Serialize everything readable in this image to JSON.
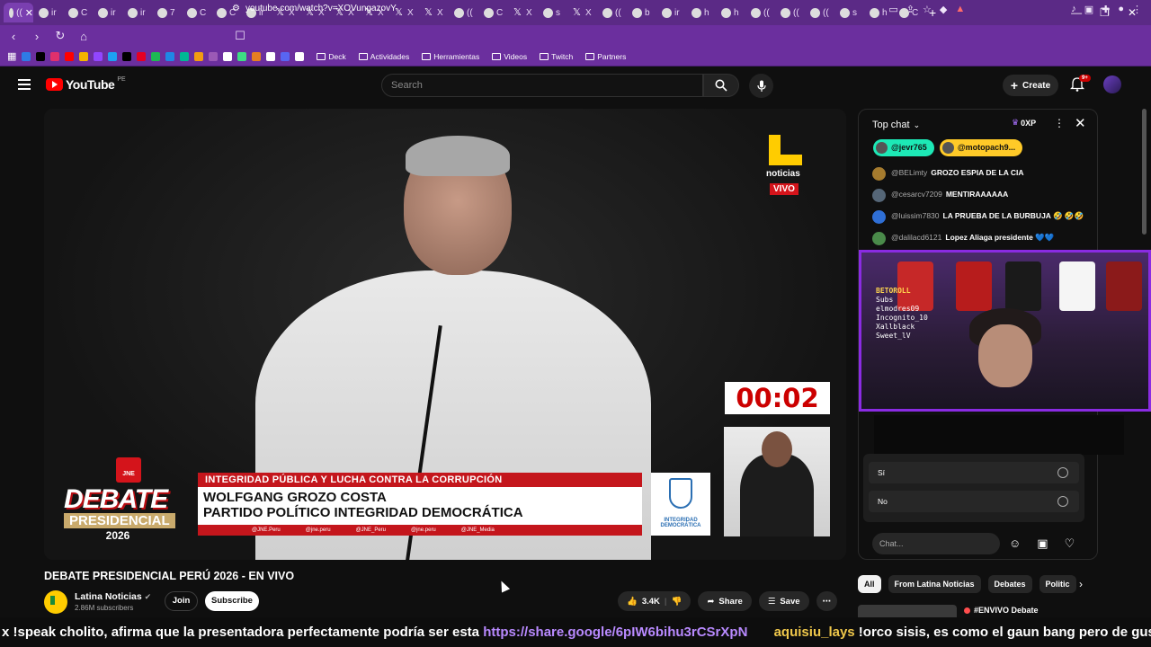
{
  "browser": {
    "tab_count_visible": 34,
    "url": "youtube.com/watch?v=XOVungazovY",
    "bookmarks": [
      "Deck",
      "Actividades",
      "Herramientas",
      "Videos",
      "Twitch",
      "Partners"
    ],
    "tab_labels": [
      "((",
      "ir",
      "C",
      "ir",
      "ir",
      "7",
      "C",
      "C",
      "ir",
      "X",
      "X",
      "X",
      "X",
      "X",
      "X",
      "((",
      "C",
      "X",
      "s",
      "X",
      "((",
      "b",
      "ir",
      "h",
      "h",
      "((",
      "((",
      "((",
      "s",
      "h",
      "C"
    ],
    "new_tab": "+",
    "win_controls": [
      "—",
      "❐",
      "✕"
    ]
  },
  "youtube": {
    "logo_text": "YouTube",
    "country_code": "PE",
    "search_placeholder": "Search",
    "create_label": "Create",
    "notif_badge": "9+"
  },
  "video": {
    "title": "DEBATE PRESIDENCIAL PERÚ 2026 - EN VIVO",
    "overlay": {
      "noticias": "noticias",
      "vivo": "VIVO",
      "timer": "00:02",
      "jne": "JNE",
      "debate": "DEBATE",
      "presidencial": "PRESIDENCIAL",
      "year": "2026",
      "topic": "INTEGRIDAD PÚBLICA Y LUCHA CONTRA LA CORRUPCIÓN",
      "speaker_line1": "WOLFGANG GROZO COSTA",
      "speaker_line2": "PARTIDO POLÍTICO INTEGRIDAD DEMOCRÁTICA",
      "socials": [
        "@JNE.Peru",
        "@jne.peru",
        "@JNE_Peru",
        "@jne.peru",
        "@JNE_Media"
      ],
      "party_logo_label": "INTEGRIDAD DEMOCRÁTICA"
    }
  },
  "channel": {
    "name": "Latina Noticias",
    "subscribers": "2.86M subscribers",
    "join_label": "Join",
    "subscribe_label": "Subscribe"
  },
  "actions": {
    "likes": "3.4K",
    "share": "Share",
    "save": "Save"
  },
  "chat": {
    "mode": "Top chat",
    "xp": "0XP",
    "pinned": [
      "@jevr765",
      "@motopach9..."
    ],
    "messages": [
      {
        "author": "@BELimty",
        "text": "GROZO ESPIA DE LA CIA",
        "avatar_color": "#a57b2e"
      },
      {
        "author": "@cesarcv7209",
        "text": "MENTIRAAAAAA",
        "avatar_color": "#556677"
      },
      {
        "author": "@luissim7830",
        "text": "LA PRUEBA DE LA BURBUJA 🤣 🤣🤣",
        "avatar_color": "#2f6fd6"
      },
      {
        "author": "@dalilacd6121",
        "text": "Lopez Aliaga presidente 💙💙",
        "avatar_color": "#4a8a4a"
      }
    ],
    "poll_options": [
      "Sí",
      "No"
    ],
    "input_placeholder": "Chat...",
    "streamer_overlay": [
      "BETOROLL",
      "Subs",
      "elmodres09",
      "Incognito_10",
      "Xallblack",
      "Sweet_lV"
    ]
  },
  "recommendations": {
    "chips": [
      "All",
      "From Latina Noticias",
      "Debates",
      "Politic"
    ],
    "active_chip": "All",
    "first_item_title": "#ENVIVO Debate"
  },
  "ticker": {
    "prefix": "x !speak cholito, afirma que la presentadora perfectamente podría ser esta ",
    "link": "https://share.google/6pIW6bihu3rCSrXpN",
    "user": "aquisiu_lays",
    "message": " !orco sisis, es como el gaun bang pero de gusanos"
  },
  "colors": {
    "browser_purple": "#6b2f9e",
    "yt_red": "#ff0000",
    "lower_third_red": "#c4161c",
    "noticias_yellow": "#ffcc00"
  }
}
